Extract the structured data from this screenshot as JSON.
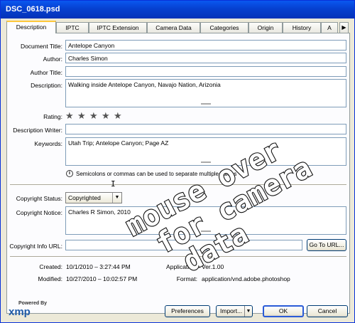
{
  "window": {
    "title": "DSC_0618.psd"
  },
  "tabs": [
    "Description",
    "IPTC",
    "IPTC Extension",
    "Camera Data",
    "Categories",
    "Origin",
    "History",
    "A"
  ],
  "tab_scroll_icon": "right-arrow-icon",
  "fields": {
    "document_title": {
      "label": "Document Title:",
      "value": "Antelope Canyon"
    },
    "author": {
      "label": "Author:",
      "value": "Charles Simon"
    },
    "author_title": {
      "label": "Author Title:",
      "value": ""
    },
    "description": {
      "label": "Description:",
      "value": "Walking inside Antelope Canyon, Navajo Nation, Arizonia"
    },
    "rating": {
      "label": "Rating:",
      "stars_filled": 0,
      "stars_total": 5
    },
    "description_writer": {
      "label": "Description Writer:",
      "value": ""
    },
    "keywords": {
      "label": "Keywords:",
      "value": "Utah Trip; Antelope Canyon; Page AZ"
    },
    "keywords_hint": "Semicolons or commas can be used to separate multiple values",
    "copyright_status": {
      "label": "Copyright Status:",
      "value": "Copyrighted"
    },
    "copyright_notice": {
      "label": "Copyright Notice:",
      "value": "Charles R Simon, 2010"
    },
    "copyright_info_url": {
      "label": "Copyright Info URL:",
      "value": "",
      "go_button": "Go To URL..."
    }
  },
  "info": {
    "created_label": "Created:",
    "created": "10/1/2010 – 3:27:44 PM",
    "modified_label": "Modified:",
    "modified": "10/27/2010 – 10:02:57 PM",
    "application_label": "Application:",
    "application": "Ver.1.00",
    "format_label": "Format:",
    "format": "application/vnd.adobe.photoshop"
  },
  "logo": {
    "powered_by": "Powered By",
    "name": "xmp"
  },
  "buttons": {
    "preferences": "Preferences",
    "import": "Import...",
    "ok": "OK",
    "cancel": "Cancel"
  },
  "overlay_text": [
    "mouse over",
    "for camera",
    "data"
  ]
}
